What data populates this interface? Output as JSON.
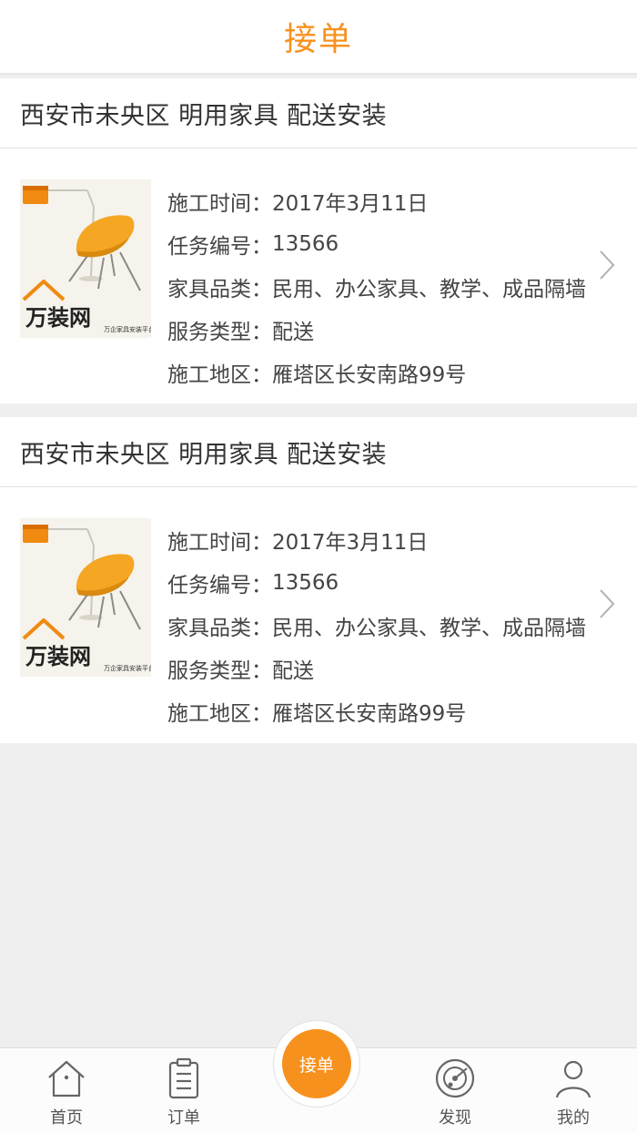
{
  "header": {
    "title": "接单"
  },
  "orders": [
    {
      "title": "西安市未央区 明用家具 配送安装",
      "fields": [
        {
          "label": "施工时间：",
          "value": "2017年3月11日"
        },
        {
          "label": "任务编号：",
          "value": "13566"
        },
        {
          "label": "家具品类：",
          "value": "民用、办公家具、教学、成品隔墙"
        },
        {
          "label": "服务类型：",
          "value": "配送"
        },
        {
          "label": "施工地区：",
          "value": "雁塔区长安南路99号"
        }
      ],
      "thumbnail": {
        "brand": "万装网",
        "tagline": "万企家具安装平台"
      }
    },
    {
      "title": "西安市未央区 明用家具 配送安装",
      "fields": [
        {
          "label": "施工时间：",
          "value": "2017年3月11日"
        },
        {
          "label": "任务编号：",
          "value": "13566"
        },
        {
          "label": "家具品类：",
          "value": "民用、办公家具、教学、成品隔墙"
        },
        {
          "label": "服务类型：",
          "value": "配送"
        },
        {
          "label": "施工地区：",
          "value": "雁塔区长安南路99号"
        }
      ],
      "thumbnail": {
        "brand": "万装网",
        "tagline": "万企家具安装平台"
      }
    }
  ],
  "tabbar": {
    "items": [
      {
        "label": "首页",
        "icon": "home-icon"
      },
      {
        "label": "订单",
        "icon": "clipboard-icon"
      },
      {
        "label": "发现",
        "icon": "radar-icon"
      },
      {
        "label": "我的",
        "icon": "user-icon"
      }
    ],
    "center_button": {
      "label": "接单"
    }
  },
  "colors": {
    "accent": "#f7911e",
    "background": "#efefef",
    "text": "#333333"
  }
}
